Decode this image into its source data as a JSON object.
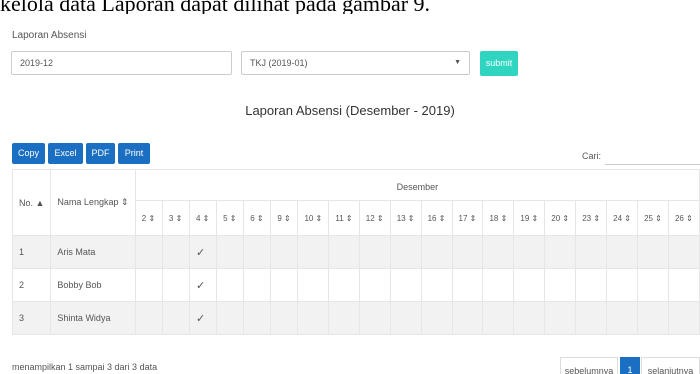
{
  "doc_caption": "kelola data Laporan dapat dilihat pada gambar 9.",
  "panel": {
    "title": "Laporan Absensi"
  },
  "filters": {
    "period_value": "2019-12",
    "class_value": "TKJ (2019-01)",
    "submit_label": "submit"
  },
  "report": {
    "title": "Laporan Absensi (Desember - 2019)"
  },
  "export_buttons": {
    "copy": "Copy",
    "excel": "Excel",
    "pdf": "PDF",
    "print": "Print"
  },
  "search": {
    "label": "Cari:",
    "value": ""
  },
  "table": {
    "col_no": "No. ▲",
    "col_name": "Nama Lengkap ⇕",
    "month": "Desember",
    "days": [
      "2 ⇕",
      "3 ⇕",
      "4 ⇕",
      "5 ⇕",
      "6 ⇕",
      "9 ⇕",
      "10 ⇕",
      "11 ⇕",
      "12 ⇕",
      "13 ⇕",
      "16 ⇕",
      "17 ⇕",
      "18 ⇕",
      "19 ⇕",
      "20 ⇕",
      "23 ⇕",
      "24 ⇕",
      "25 ⇕",
      "26 ⇕"
    ],
    "rows": [
      {
        "no": "1",
        "name": "Aris Mata",
        "attendance": [
          "",
          "",
          "✓",
          "",
          "",
          "",
          "",
          "",
          "",
          "",
          "",
          "",
          "",
          "",
          "",
          "",
          "",
          "",
          ""
        ]
      },
      {
        "no": "2",
        "name": "Bobby Bob",
        "attendance": [
          "",
          "",
          "✓",
          "",
          "",
          "",
          "",
          "",
          "",
          "",
          "",
          "",
          "",
          "",
          "",
          "",
          "",
          "",
          ""
        ]
      },
      {
        "no": "3",
        "name": "Shinta Widya",
        "attendance": [
          "",
          "",
          "✓",
          "",
          "",
          "",
          "",
          "",
          "",
          "",
          "",
          "",
          "",
          "",
          "",
          "",
          "",
          "",
          ""
        ]
      }
    ]
  },
  "footer": {
    "info": "menampilkan 1 sampai 3 dari 3 data",
    "prev": "sebelumnya",
    "page": "1",
    "next": "selanjutnya"
  },
  "colors": {
    "primary": "#1b6fc2",
    "submit": "#2fd5c1",
    "stripe": "#f2f2f2"
  }
}
